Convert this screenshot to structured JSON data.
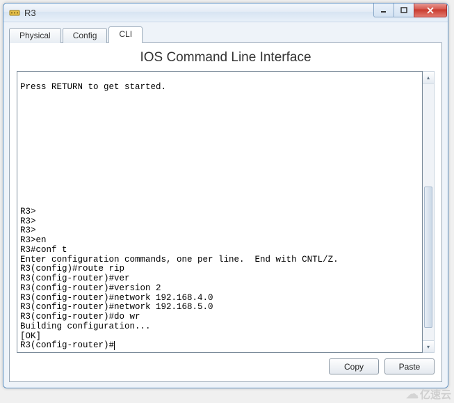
{
  "window": {
    "title": "R3"
  },
  "tabs": {
    "physical": "Physical",
    "config": "Config",
    "cli": "CLI"
  },
  "panel": {
    "title": "IOS Command Line Interface"
  },
  "terminal": {
    "lines": "\nPress RETURN to get started.\n\n\n\n\n\n\n\n\n\n\n\n\nR3>\nR3>\nR3>\nR3>en\nR3#conf t\nEnter configuration commands, one per line.  End with CNTL/Z.\nR3(config)#route rip\nR3(config-router)#ver\nR3(config-router)#version 2\nR3(config-router)#network 192.168.4.0\nR3(config-router)#network 192.168.5.0\nR3(config-router)#do wr\nBuilding configuration...\n[OK]\nR3(config-router)#"
  },
  "buttons": {
    "copy": "Copy",
    "paste": "Paste"
  },
  "watermark": {
    "text": "亿速云"
  }
}
